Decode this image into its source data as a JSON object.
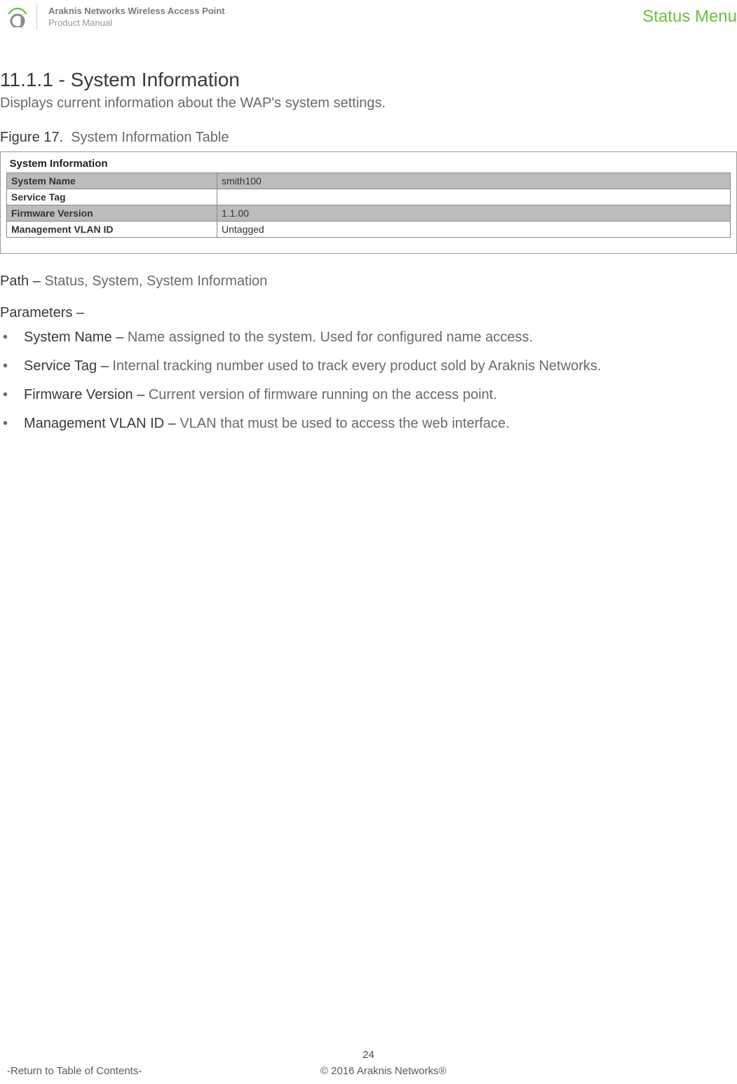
{
  "header": {
    "title_line1": "Araknis Networks Wireless Access Point",
    "title_line2": "Product Manual",
    "status_menu": "Status Menu"
  },
  "section": {
    "heading": "11.1.1 - System Information",
    "description": "Displays current information about the WAP's system settings."
  },
  "figure": {
    "label_num": "Figure 17.",
    "label_text": "System Information Table",
    "table": {
      "title": "System Information",
      "rows": [
        {
          "label": "System Name",
          "value": "smith100",
          "shaded": true
        },
        {
          "label": "Service Tag",
          "value": "",
          "shaded": false
        },
        {
          "label": "Firmware Version",
          "value": "1.1.00",
          "shaded": true
        },
        {
          "label": "Management VLAN ID",
          "value": "Untagged",
          "shaded": false
        }
      ]
    }
  },
  "path": {
    "label": "Path – ",
    "value": "Status, System, System Information"
  },
  "parameters": {
    "heading": "Parameters –",
    "items": [
      {
        "term": "System Name – ",
        "desc": "Name assigned to the system. Used for configured name access."
      },
      {
        "term": "Service Tag – ",
        "desc": "Internal tracking number used to track every product sold by Araknis Networks."
      },
      {
        "term": "Firmware Version – ",
        "desc": "Current version of firmware running on the access point."
      },
      {
        "term": "Management VLAN ID – ",
        "desc": "VLAN that must be used to access the web interface."
      }
    ]
  },
  "footer": {
    "page": "24",
    "toc_link": "-Return to Table of Contents-",
    "copyright": "© 2016 Araknis Networks®"
  }
}
